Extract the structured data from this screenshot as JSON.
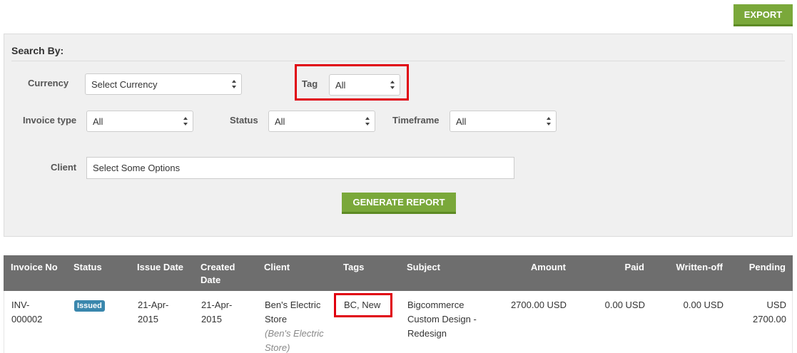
{
  "toolbar": {
    "export_label": "EXPORT"
  },
  "search": {
    "title": "Search By:",
    "currency": {
      "label": "Currency",
      "value": "Select Currency"
    },
    "tag": {
      "label": "Tag",
      "value": "All"
    },
    "invoice_type": {
      "label": "Invoice type",
      "value": "All"
    },
    "status": {
      "label": "Status",
      "value": "All"
    },
    "timeframe": {
      "label": "Timeframe",
      "value": "All"
    },
    "client": {
      "label": "Client",
      "placeholder": "Select Some Options"
    },
    "generate_label": "GENERATE REPORT"
  },
  "table": {
    "columns": [
      "Invoice No",
      "Status",
      "Issue Date",
      "Created Date",
      "Client",
      "Tags",
      "Subject",
      "Amount",
      "Paid",
      "Written-off",
      "Pending"
    ],
    "rows": [
      {
        "invoice_no": "INV-000002",
        "status": "Issued",
        "issue_date": "21-Apr-2015",
        "created_date": "21-Apr-2015",
        "client": "Ben's Electric Store",
        "client_sub": "(Ben's Electric Store)",
        "tags": "BC, New",
        "subject": "Bigcommerce Custom Design - Redesign",
        "amount": "2700.00 USD",
        "paid": "0.00 USD",
        "written_off": "0.00 USD",
        "pending": "USD 2700.00"
      }
    ]
  },
  "colors": {
    "accent_green": "#7aa83a",
    "badge_blue": "#3a87ad",
    "header_gray": "#6e6e6e",
    "highlight_red": "#e0000e"
  }
}
